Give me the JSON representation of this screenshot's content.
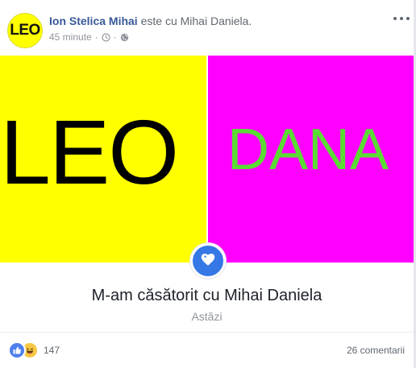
{
  "post": {
    "avatar_text": "LEO",
    "author": "Ion Stelica Mihai",
    "tag_phrase": "este cu",
    "tagged_person": "Mihai Daniela.",
    "time": "45 minute",
    "separator": "·"
  },
  "media": {
    "left_text": "LEO",
    "right_text": "DANA",
    "left_bg": "#ffff00",
    "right_bg": "#ff00ff",
    "right_text_color": "#5bdc34"
  },
  "life_event": {
    "icon": "heart-icon",
    "title": "M-am căsătorit cu Mihai Daniela",
    "subtitle": "Astăzi"
  },
  "footer": {
    "reaction_icons": [
      "like-icon",
      "haha-icon"
    ],
    "reaction_count": "147",
    "comments": "26 comentarii"
  },
  "colors": {
    "author_link": "#385898",
    "accent_blue": "#3578e5"
  }
}
